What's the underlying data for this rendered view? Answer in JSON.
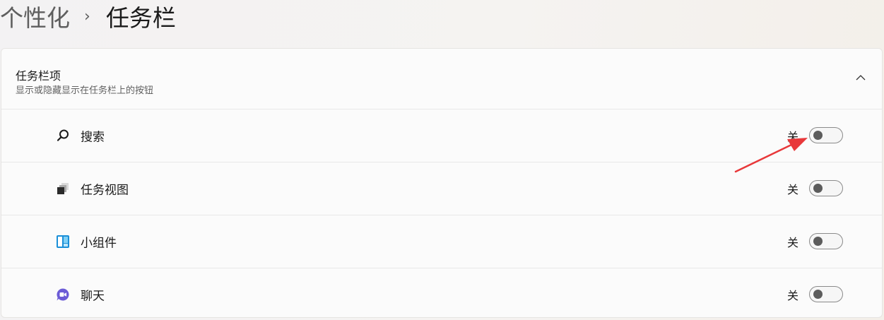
{
  "breadcrumb": {
    "parent": "个性化",
    "separator": "›",
    "current": "任务栏"
  },
  "section": {
    "title": "任务栏项",
    "subtitle": "显示或隐藏显示在任务栏上的按钮"
  },
  "items": [
    {
      "label": "搜索",
      "state": "关",
      "on": false,
      "icon": "search-icon"
    },
    {
      "label": "任务视图",
      "state": "关",
      "on": false,
      "icon": "task-view-icon"
    },
    {
      "label": "小组件",
      "state": "关",
      "on": false,
      "icon": "widgets-icon"
    },
    {
      "label": "聊天",
      "state": "关",
      "on": false,
      "icon": "chat-icon"
    }
  ],
  "colors": {
    "arrow": "#e8383a",
    "toggle_knob": "#5c5c5c",
    "widgets_blue": "#1a8fd8",
    "chat_purple": "#6b5bd6"
  }
}
